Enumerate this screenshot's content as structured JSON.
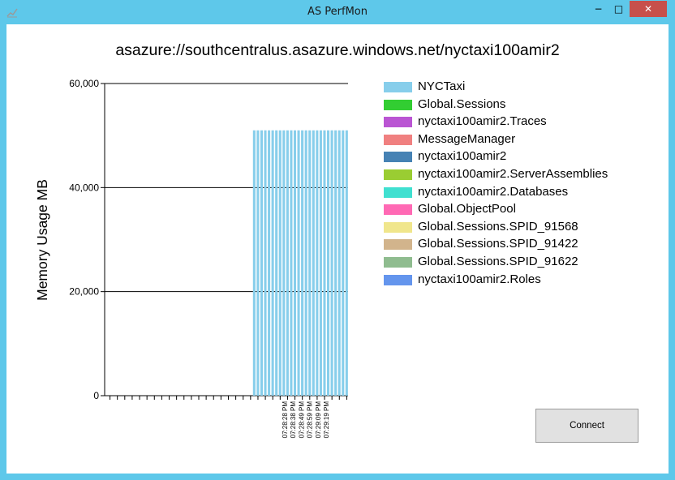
{
  "window": {
    "title": "AS PerfMon",
    "minimize_label": "−",
    "maximize_label": "□",
    "close_label": "✕"
  },
  "header": {
    "server_url": "asazure://southcentralus.asazure.windows.net/nyctaxi100amir2"
  },
  "legend": {
    "items": [
      {
        "label": "NYCTaxi",
        "color": "#87ceeb"
      },
      {
        "label": "Global.Sessions",
        "color": "#32cd32"
      },
      {
        "label": "nyctaxi100amir2.Traces",
        "color": "#ba55d3"
      },
      {
        "label": "MessageManager",
        "color": "#f08080"
      },
      {
        "label": "nyctaxi100amir2",
        "color": "#4682b4"
      },
      {
        "label": "nyctaxi100amir2.ServerAssemblies",
        "color": "#9acd32"
      },
      {
        "label": "nyctaxi100amir2.Databases",
        "color": "#40e0d0"
      },
      {
        "label": "Global.ObjectPool",
        "color": "#ff69b4"
      },
      {
        "label": "Global.Sessions.SPID_91568",
        "color": "#f0e68c"
      },
      {
        "label": "Global.Sessions.SPID_91422",
        "color": "#d2b48c"
      },
      {
        "label": "Global.Sessions.SPID_91622",
        "color": "#8fbc8f"
      },
      {
        "label": "nyctaxi100amir2.Roles",
        "color": "#6495ed"
      }
    ]
  },
  "chart_data": {
    "type": "bar",
    "ylabel": "Memory Usage MB",
    "ylim": [
      0,
      60000
    ],
    "yticks": [
      "0",
      "20,000",
      "40,000",
      "60,000"
    ],
    "grid": true,
    "legend_position": "right",
    "x_tick_labels": [
      "07:28:28 PM",
      "07:28:38 PM",
      "07:28:49 PM",
      "07:28:59 PM",
      "07:29:09 PM",
      "07:29:19 PM"
    ],
    "series": [
      {
        "name": "NYCTaxi",
        "color": "#87ceeb",
        "values": [
          51000,
          51000,
          51000,
          51000,
          51000,
          51000,
          51000,
          51000,
          51000,
          51000,
          51000,
          51000,
          51000,
          51000,
          51000,
          51000,
          51000,
          51000,
          51000,
          51000,
          51000,
          51000,
          51000,
          51000,
          51000,
          51000
        ]
      }
    ]
  },
  "footer": {
    "connect_label": "Connect"
  }
}
